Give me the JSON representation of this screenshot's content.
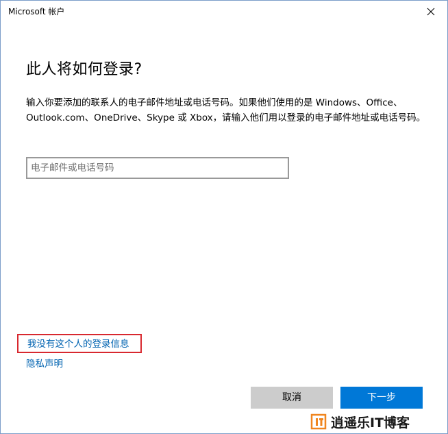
{
  "window": {
    "title": "Microsoft 帐户"
  },
  "main": {
    "heading": "此人将如何登录?",
    "description": "输入你要添加的联系人的电子邮件地址或电话号码。如果他们使用的是 Windows、Office、Outlook.com、OneDrive、Skype 或 Xbox，请输入他们用以登录的电子邮件地址或电话号码。",
    "email_input": {
      "placeholder": "电子邮件或电话号码",
      "value": ""
    }
  },
  "links": {
    "no_signin_info": "我没有这个人的登录信息",
    "privacy": "隐私声明"
  },
  "buttons": {
    "cancel": "取消",
    "next": "下一步"
  },
  "watermark": {
    "text": "逍遥乐IT博客"
  },
  "colors": {
    "link": "#0063b1",
    "primary_button": "#0078d7",
    "secondary_button": "#cccccc",
    "highlight_border": "#d8282f",
    "watermark_orange": "#f0851e"
  },
  "icons": {
    "close": "close-icon"
  }
}
